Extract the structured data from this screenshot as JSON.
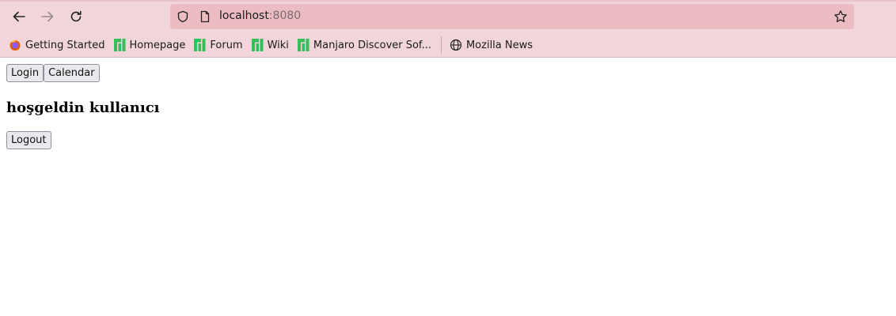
{
  "browser": {
    "url_host": "localhost",
    "url_port": ":8080",
    "bookmarks": [
      {
        "label": "Getting Started",
        "icon": "firefox-icon"
      },
      {
        "label": "Homepage",
        "icon": "manjaro-icon"
      },
      {
        "label": "Forum",
        "icon": "manjaro-icon"
      },
      {
        "label": "Wiki",
        "icon": "manjaro-icon"
      },
      {
        "label": "Manjaro Discover Sof...",
        "icon": "manjaro-icon"
      },
      {
        "label": "Mozilla News",
        "icon": "globe-icon"
      }
    ],
    "colors": {
      "chrome_bg": "#f1d5da",
      "urlbar_bg": "#ecbcc3",
      "manjaro_green": "#35bf5c"
    }
  },
  "page": {
    "buttons": {
      "login": "Login",
      "calendar": "Calendar",
      "logout": "Logout"
    },
    "welcome_text": "hoşgeldin kullanıcı"
  }
}
